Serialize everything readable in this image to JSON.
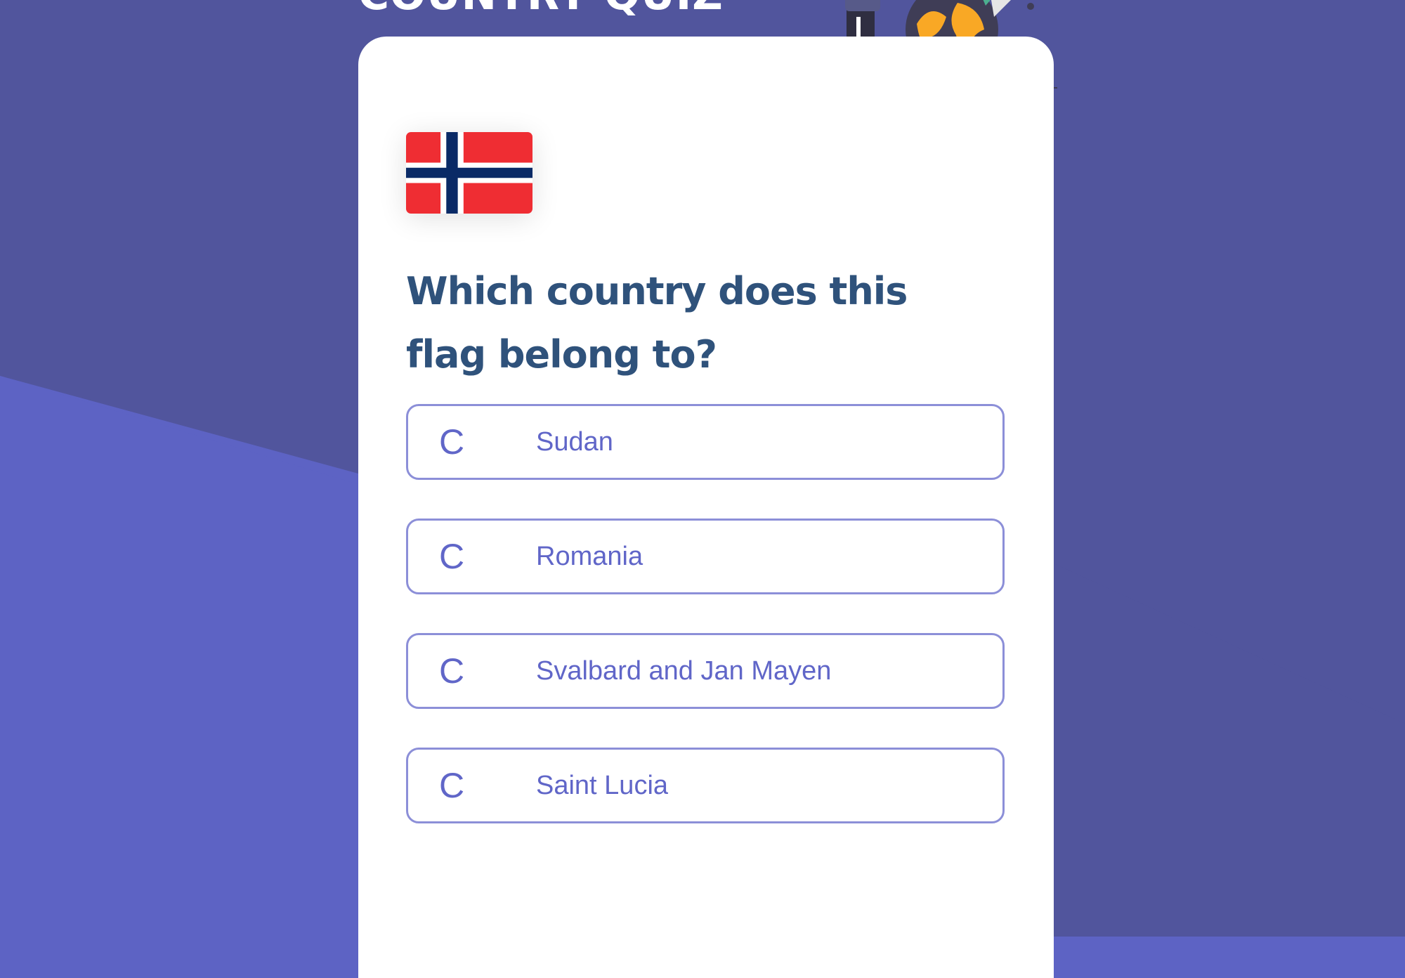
{
  "app": {
    "title": "COUNTRY QUIZ"
  },
  "question": {
    "text": "Which country does this flag belong to?",
    "flag_icon": "norway-flag"
  },
  "options": [
    {
      "letter": "C",
      "label": "Sudan"
    },
    {
      "letter": "C",
      "label": "Romania"
    },
    {
      "letter": "C",
      "label": "Svalbard and Jan Mayen"
    },
    {
      "letter": "C",
      "label": "Saint Lucia"
    }
  ],
  "colors": {
    "background": "#5d63c4",
    "background_stripe": "#51559d",
    "card": "#ffffff",
    "question_text": "#2f527b",
    "option_text": "#6066c8",
    "option_border": "#8c8fd8",
    "flag_red": "#ef2d33",
    "flag_blue": "#0a2a66"
  }
}
